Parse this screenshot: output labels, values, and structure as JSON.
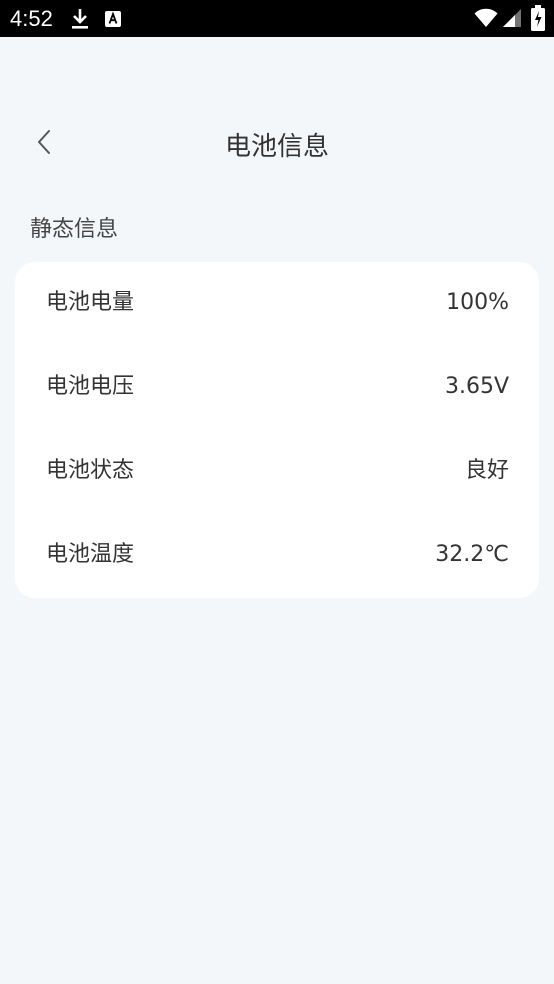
{
  "status_bar": {
    "time": "4:52",
    "icons": [
      "download-icon",
      "text-input-icon",
      "wifi-icon",
      "signal-icon",
      "battery-icon"
    ]
  },
  "header": {
    "back_icon": "chevron-left-icon",
    "title": "电池信息"
  },
  "section": {
    "title": "静态信息"
  },
  "battery_info": [
    {
      "label": "电池电量",
      "value": "100%"
    },
    {
      "label": "电池电压",
      "value": "3.65V"
    },
    {
      "label": "电池状态",
      "value": "良好"
    },
    {
      "label": "电池温度",
      "value": "32.2℃"
    }
  ],
  "colors": {
    "background": "#f4f7fa",
    "card": "#ffffff",
    "text": "#333333",
    "status_bar": "#000000"
  }
}
